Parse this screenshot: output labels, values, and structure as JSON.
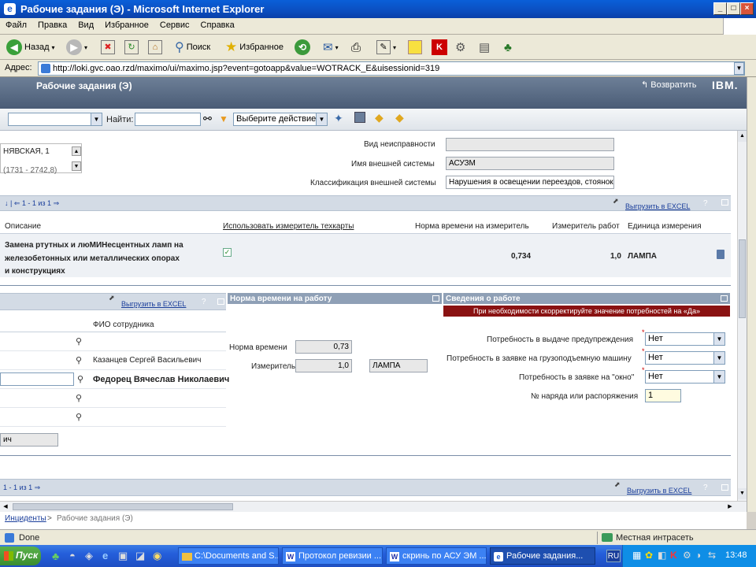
{
  "window": {
    "title": "Рабочие задания (Э) - Microsoft Internet Explorer"
  },
  "menu": [
    "Файл",
    "Правка",
    "Вид",
    "Избранное",
    "Сервис",
    "Справка"
  ],
  "toolbar": {
    "back": "Назад",
    "search": "Поиск",
    "favorites": "Избранное"
  },
  "address": {
    "label": "Адрес:",
    "url": "http://loki.gvc.oao.rzd/maximo/ui/maximo.jsp?event=gotoapp&value=WOTRACK_E&uisessionid=319"
  },
  "app": {
    "title": "Рабочие задания (Э)",
    "return": "Возвратить",
    "brand": "IBM."
  },
  "actions": {
    "find_label": "Найти:",
    "action_select": "Выберите действие"
  },
  "location": {
    "line1": "НЯВСКАЯ, 1",
    "line2": "(1731 - 2742,8)"
  },
  "fields": {
    "fault_type": {
      "label": "Вид неисправности",
      "value": ""
    },
    "ext_system": {
      "label": "Имя внешней системы",
      "value": "АСУЗМ"
    },
    "ext_class": {
      "label": "Классификация внешней системы",
      "value": "Нарушения в освещении переездов, стоянок"
    }
  },
  "tasks_table": {
    "nav": "1 - 1 из 1",
    "excel": "Выгрузить в EXCEL",
    "headers": [
      "Описание",
      "Использовать измеритель техкарты",
      "Норма времени на измеритель",
      "Измеритель работ",
      "Единица измерения"
    ],
    "row": {
      "desc1": "Замена ртутных и люМИНесцентных ламп на",
      "desc2": "железобетонных или металлических опорах",
      "desc3": "и конструкциях",
      "norm": "0,734",
      "meter": "1,0",
      "unit": "ЛАМПА"
    }
  },
  "workers": {
    "excel": "Выгрузить в EXCEL",
    "col": "ФИО сотрудника",
    "rows": [
      "",
      "Казанцев Сергей Васильевич",
      "Федорец Вячеслав Николаевич",
      "",
      ""
    ],
    "footer_field": "ич"
  },
  "norm_panel": {
    "header": "Норма времени на работу",
    "norm_label": "Норма времени",
    "norm_value": "0,73",
    "meter_label": "Измеритель",
    "meter_value": "1,0",
    "unit": "ЛАМПА"
  },
  "info_panel": {
    "header": "Сведения о работе",
    "warning": "При необходимости скорректируйте значение потребностей на «Да»",
    "rows": [
      {
        "label": "Потребность в выдаче предупреждения",
        "value": "Нет"
      },
      {
        "label": "Потребность в заявке на грузоподъемную машину",
        "value": "Нет"
      },
      {
        "label": "Потребность в заявке на \"окно\"",
        "value": "Нет"
      }
    ],
    "order_label": "№ наряда или распоряжения",
    "order_value": "1"
  },
  "bottom_section": {
    "nav": "1 - 1 из 1",
    "excel": "Выгрузить в EXCEL"
  },
  "breadcrumb": {
    "link": "Инциденты",
    "sep": " > ",
    "current": "Рабочие задания (Э)"
  },
  "status": {
    "left": "Done",
    "zone": "Местная интрасеть"
  },
  "taskbar": {
    "start": "Пуск",
    "items": [
      "C:\\Documents and S...",
      "Протокол ревизии ...",
      "скринь по АСУ ЭМ ...",
      "Рабочие задания..."
    ],
    "lang": "RU",
    "clock": "13:48"
  }
}
